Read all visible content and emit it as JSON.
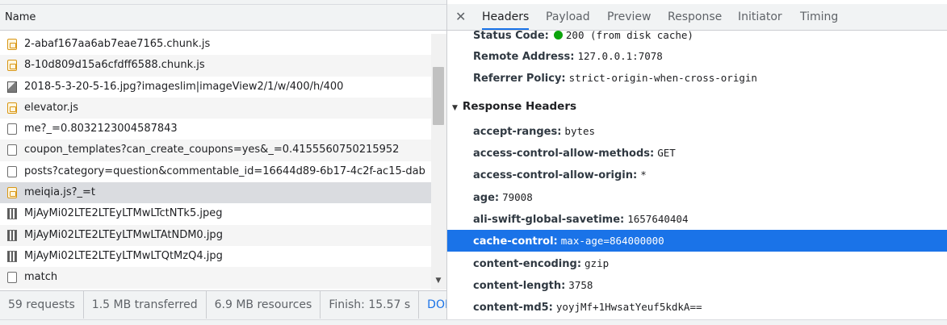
{
  "network": {
    "column_header": "Name",
    "requests": [
      {
        "name": "2-abaf167aa6ab7eae7165.chunk.js",
        "icon": "js-file-icon"
      },
      {
        "name": "8-10d809d15a6cfdff6588.chunk.js",
        "icon": "js-file-icon"
      },
      {
        "name": "2018-5-3-20-5-16.jpg?imageslim|imageView2/1/w/400/h/400",
        "icon": "image-file-icon"
      },
      {
        "name": "elevator.js",
        "icon": "js-file-icon"
      },
      {
        "name": "me?_=0.8032123004587843",
        "icon": "document-icon"
      },
      {
        "name": "coupon_templates?can_create_coupons=yes&_=0.4155560750215952",
        "icon": "document-icon"
      },
      {
        "name": "posts?category=question&commentable_id=16644d89-6b17-4c2f-ac15-dab",
        "icon": "document-icon"
      },
      {
        "name": "meiqia.js?_=t",
        "icon": "js-file-icon"
      },
      {
        "name": "MjAyMi02LTE2LTEyLTMwLTctNTk5.jpeg",
        "icon": "qr-image-icon"
      },
      {
        "name": "MjAyMi02LTE2LTEyLTMwLTAtNDM0.jpg",
        "icon": "qr-image-icon"
      },
      {
        "name": "MjAyMi02LTE2LTEyLTMwLTQtMzQ4.jpg",
        "icon": "qr-image-icon"
      },
      {
        "name": "match",
        "icon": "document-icon"
      }
    ],
    "status_bar": {
      "requests": "59 requests",
      "transferred": "1.5 MB transferred",
      "resources": "6.9 MB resources",
      "finish": "Finish: 15.57 s",
      "dom": "DOMC"
    }
  },
  "details": {
    "tabs": [
      "Headers",
      "Payload",
      "Preview",
      "Response",
      "Initiator",
      "Timing"
    ],
    "active_tab": "Headers",
    "general": [
      {
        "key": "Status Code:",
        "value": "200  (from disk cache)"
      },
      {
        "key": "Remote Address:",
        "value": "127.0.0.1:7078"
      },
      {
        "key": "Referrer Policy:",
        "value": "strict-origin-when-cross-origin"
      }
    ],
    "response_headers_title": "Response Headers",
    "response_headers": [
      {
        "key": "accept-ranges:",
        "value": "bytes"
      },
      {
        "key": "access-control-allow-methods:",
        "value": "GET"
      },
      {
        "key": "access-control-allow-origin:",
        "value": "*"
      },
      {
        "key": "age:",
        "value": "79008"
      },
      {
        "key": "ali-swift-global-savetime:",
        "value": "1657640404"
      },
      {
        "key": "cache-control:",
        "value": "max-age=864000000"
      },
      {
        "key": "content-encoding:",
        "value": "gzip"
      },
      {
        "key": "content-length:",
        "value": "3758"
      },
      {
        "key": "content-md5:",
        "value": "yoyjMf+1HwsatYeuf5kdkA=="
      }
    ],
    "selected_header": "cache-control:"
  },
  "colors": {
    "accent": "#1a73e8",
    "status_ok": "#0ca40c"
  }
}
